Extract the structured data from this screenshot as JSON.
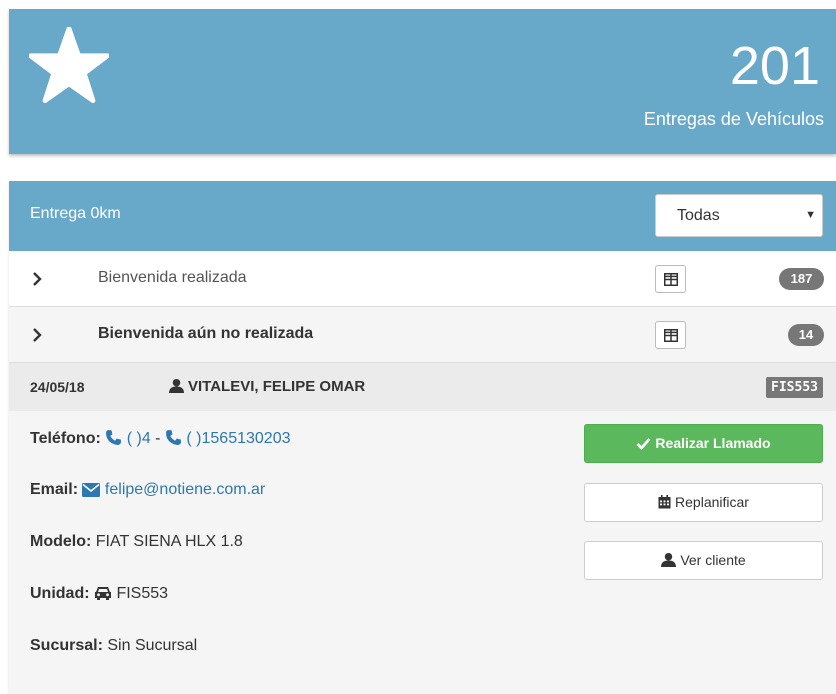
{
  "stats": {
    "value": "201",
    "label": "Entregas de Vehículos",
    "icon": "star-icon",
    "color": "#68a8c8"
  },
  "panel": {
    "title": "Entrega 0km",
    "filter": {
      "selected": "Todas"
    }
  },
  "groups": [
    {
      "label": "Bienvenida realizada",
      "count": "187"
    },
    {
      "label": "Bienvenida aún no realizada",
      "count": "14"
    }
  ],
  "entry": {
    "date": "24/05/18",
    "client_name": "VITALEVI, FELIPE OMAR",
    "plate": "FIS553"
  },
  "details": {
    "phone_label": "Teléfono:",
    "phone1": "( )4",
    "phone_sep": "-",
    "phone2": "( )1565130203",
    "email_label": "Email:",
    "email": "felipe@notiene.com.ar",
    "model_label": "Modelo:",
    "model": "FIAT SIENA HLX 1.8",
    "unit_label": "Unidad:",
    "unit": "FIS553",
    "branch_label": "Sucursal:",
    "branch": "Sin Sucursal"
  },
  "actions": {
    "call": "Realizar Llamado",
    "reschedule": "Replanificar",
    "view_client": "Ver cliente"
  },
  "colors": {
    "accent": "#68a8c8",
    "success": "#5cb85c",
    "badge": "#777777",
    "link": "#2d78b0"
  }
}
